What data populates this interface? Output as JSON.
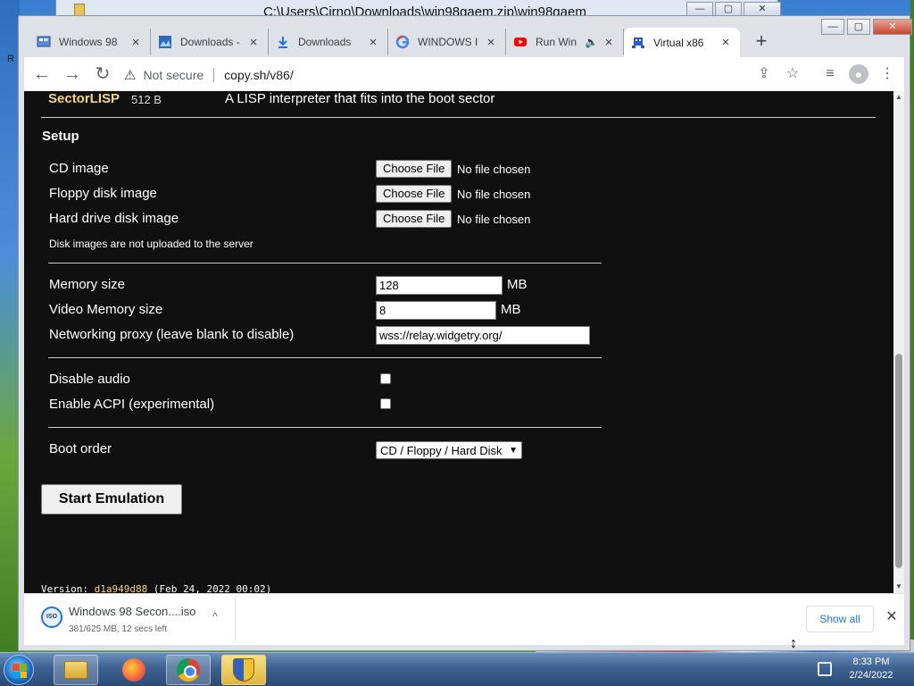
{
  "background_window": {
    "title": "C:\\Users\\Cirno\\Downloads\\win98gaem.zip\\win98gaem"
  },
  "desktop": {
    "letter": "R"
  },
  "tabs": [
    {
      "icon": "windows-icon",
      "title": "Windows 98",
      "close": "×",
      "active": false
    },
    {
      "icon": "image-icon",
      "title": "Downloads -",
      "close": "×",
      "active": false
    },
    {
      "icon": "download-icon",
      "title": "Downloads",
      "close": "×",
      "active": false
    },
    {
      "icon": "google-icon",
      "title": "WINDOWS I",
      "close": "×",
      "active": false
    },
    {
      "icon": "youtube-icon",
      "title": "Run Win",
      "close": "×",
      "active": false,
      "muted_icon": "🔈"
    },
    {
      "icon": "v86-icon",
      "title": "Virtual x86",
      "close": "×",
      "active": true
    }
  ],
  "new_tab": "+",
  "window_controls": {
    "minimize": "—",
    "maximize": "▢",
    "close": "✕"
  },
  "toolbar": {
    "back": "←",
    "forward": "→",
    "reload": "↻",
    "security_label": "Not secure",
    "url": "copy.sh/v86/",
    "share": "⇪",
    "bookmark": "☆",
    "media": "≡",
    "profile": "●",
    "menu": "⋮"
  },
  "page": {
    "lisp": {
      "name": "SectorLISP",
      "size": "512 B",
      "desc": "A LISP interpreter that fits into the boot sector"
    },
    "setup_heading": "Setup",
    "file_inputs": [
      {
        "label": "CD image",
        "button": "Choose File",
        "status": "No file chosen"
      },
      {
        "label": "Floppy disk image",
        "button": "Choose File",
        "status": "No file chosen"
      },
      {
        "label": "Hard drive disk image",
        "button": "Choose File",
        "status": "No file chosen"
      }
    ],
    "disk_note": "Disk images are not uploaded to the server",
    "memory": {
      "label": "Memory size",
      "value": "128",
      "unit": "MB"
    },
    "video_memory": {
      "label": "Video Memory size",
      "value": "8",
      "unit": "MB"
    },
    "proxy": {
      "label": "Networking proxy (leave blank to disable)",
      "value": "wss://relay.widgetry.org/"
    },
    "disable_audio": {
      "label": "Disable audio",
      "checked": false
    },
    "acpi": {
      "label": "Enable ACPI (experimental)",
      "checked": false
    },
    "boot_order": {
      "label": "Boot order",
      "value": "CD / Floppy / Hard Disk"
    },
    "start_button": "Start Emulation",
    "version": {
      "prefix": "Version: ",
      "hash": "d1a949d88",
      "date": " (Feb 24, 2022 00:02)"
    }
  },
  "download_shelf": {
    "file_name": "Windows 98 Secon....iso",
    "progress": "381/625 MB, 12 secs left",
    "icon_label": "ISO",
    "menu_caret": "^",
    "show_all": "Show all",
    "close": "✕"
  },
  "taskbar": {
    "apps": [
      "file-explorer",
      "firefox",
      "chrome",
      "uac-shield"
    ],
    "time": "8:33 PM",
    "date": "2/24/2022"
  },
  "colors": {
    "page_bg": "#101010",
    "accent_yellow": "#f7d774",
    "chrome_tab_bg": "#dee1e6"
  }
}
